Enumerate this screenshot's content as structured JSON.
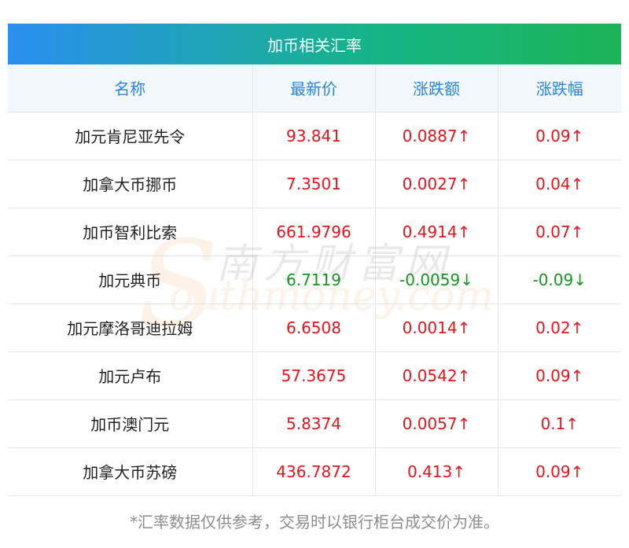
{
  "title": "加币相关汇率",
  "headers": [
    "名称",
    "最新价",
    "涨跌额",
    "涨跌幅"
  ],
  "rows": [
    {
      "name": "加元肯尼亚先令",
      "price": "93.841",
      "change": "0.0887↑",
      "pct": "0.09↑",
      "dir": "up"
    },
    {
      "name": "加拿大币挪币",
      "price": "7.3501",
      "change": "0.0027↑",
      "pct": "0.04↑",
      "dir": "up"
    },
    {
      "name": "加币智利比索",
      "price": "661.9796",
      "change": "0.4914↑",
      "pct": "0.07↑",
      "dir": "up"
    },
    {
      "name": "加元典币",
      "price": "6.7119",
      "change": "-0.0059↓",
      "pct": "-0.09↓",
      "dir": "down"
    },
    {
      "name": "加元摩洛哥迪拉姆",
      "price": "6.6508",
      "change": "0.0014↑",
      "pct": "0.02↑",
      "dir": "up"
    },
    {
      "name": "加元卢布",
      "price": "57.3675",
      "change": "0.0542↑",
      "pct": "0.09↑",
      "dir": "up"
    },
    {
      "name": "加币澳门元",
      "price": "5.8374",
      "change": "0.0057↑",
      "pct": "0.1↑",
      "dir": "up"
    },
    {
      "name": "加拿大币苏磅",
      "price": "436.7872",
      "change": "0.413↑",
      "pct": "0.09↑",
      "dir": "up"
    }
  ],
  "watermark": {
    "cn": "南方财富网",
    "en": "outhmoney.com",
    "s": "S"
  },
  "footnote": "*汇率数据仅供参考，交易时以银行柜台成交价为准。",
  "colors": {
    "up": "#e6141c",
    "down": "#13981e",
    "header_text": "#2a86e0",
    "title_gradient_start": "#2a8ff0",
    "title_gradient_end": "#1cb456"
  }
}
